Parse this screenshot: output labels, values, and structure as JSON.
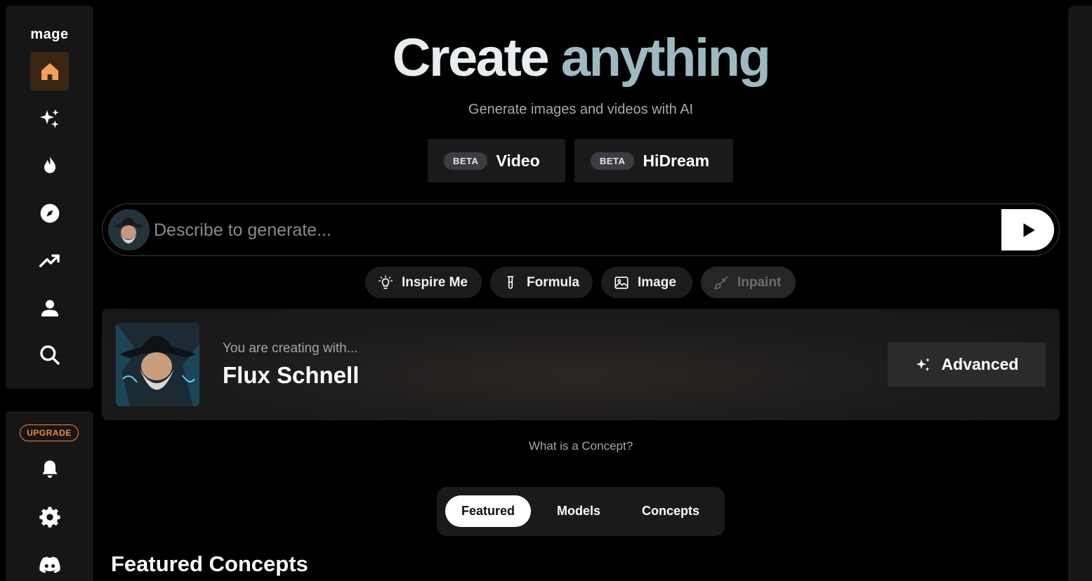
{
  "sidebar": {
    "logo": "mage",
    "nav_items": [
      {
        "name": "home",
        "icon": "home-icon",
        "active": true
      },
      {
        "name": "create",
        "icon": "sparkles-icon"
      },
      {
        "name": "hot",
        "icon": "flame-icon"
      },
      {
        "name": "explore",
        "icon": "compass-icon"
      },
      {
        "name": "trending",
        "icon": "trending-up-icon"
      },
      {
        "name": "profile",
        "icon": "user-icon"
      },
      {
        "name": "search",
        "icon": "search-icon"
      }
    ],
    "upgrade_label": "UPGRADE",
    "bottom_items": [
      {
        "name": "notifications",
        "icon": "bell-icon"
      },
      {
        "name": "settings",
        "icon": "gear-icon"
      },
      {
        "name": "discord",
        "icon": "discord-icon"
      }
    ]
  },
  "hero": {
    "title_part1": "Create",
    "title_part2": "anything",
    "subtitle": "Generate images and videos with AI"
  },
  "beta_buttons": [
    {
      "badge": "BETA",
      "label": "Video"
    },
    {
      "badge": "BETA",
      "label": "HiDream"
    }
  ],
  "prompt": {
    "placeholder": "Describe to generate...",
    "value": ""
  },
  "tools": [
    {
      "label": "Inspire Me",
      "icon": "lightbulb-icon",
      "enabled": true
    },
    {
      "label": "Formula",
      "icon": "test-tube-icon",
      "enabled": true
    },
    {
      "label": "Image",
      "icon": "image-icon",
      "enabled": true
    },
    {
      "label": "Inpaint",
      "icon": "brush-icon",
      "enabled": false
    }
  ],
  "model_card": {
    "kicker": "You are creating with...",
    "model_name": "Flux Schnell",
    "advanced_label": "Advanced"
  },
  "concept_link": "What is a Concept?",
  "tabs": [
    {
      "label": "Featured",
      "active": true
    },
    {
      "label": "Models",
      "active": false
    },
    {
      "label": "Concepts",
      "active": false
    }
  ],
  "section_title": "Featured Concepts",
  "colors": {
    "accent": "#f08a3c",
    "title_gradient_end": "#9fb9c0",
    "background": "#000000",
    "panel": "#161616"
  }
}
